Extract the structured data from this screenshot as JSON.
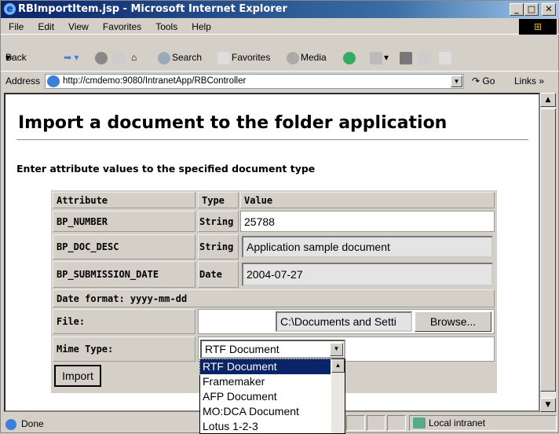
{
  "window": {
    "title": "RBImportItem.jsp - Microsoft Internet Explorer"
  },
  "menu": [
    "File",
    "Edit",
    "View",
    "Favorites",
    "Tools",
    "Help"
  ],
  "toolbar": {
    "back": "Back",
    "search": "Search",
    "favorites": "Favorites",
    "media": "Media"
  },
  "address": {
    "label": "Address",
    "url": "http://cmdemo:9080/IntranetApp/RBController",
    "go": "Go",
    "links": "Links"
  },
  "page": {
    "heading": "Import a document to the folder application",
    "subtitle": "Enter attribute values to the specified document type",
    "table": {
      "headers": [
        "Attribute",
        "Type",
        "Value"
      ],
      "rows": [
        {
          "attr": "BP_NUMBER",
          "type": "String",
          "value": "25788"
        },
        {
          "attr": "BP_DOC_DESC",
          "type": "String",
          "value": "Application sample document"
        },
        {
          "attr": "BP_SUBMISSION_DATE",
          "type": "Date",
          "value": "2004-07-27"
        }
      ],
      "date_format": "Date format: yyyy-mm-dd",
      "file_label": "File:",
      "file_value": "C:\\Documents and Setti",
      "browse": "Browse...",
      "mime_label": "Mime Type:",
      "mime_selected": "RTF Document",
      "mime_options": [
        "RTF Document",
        "Framemaker",
        "AFP Document",
        "MO:DCA Document",
        "Lotus 1-2-3"
      ],
      "import": "Import"
    }
  },
  "status": {
    "text": "Done",
    "zone": "Local intranet"
  }
}
